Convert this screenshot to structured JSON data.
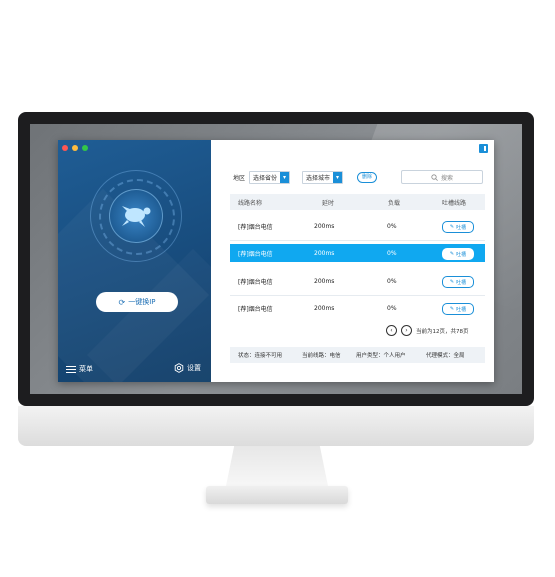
{
  "sidebar": {
    "connect_label": "一键换IP",
    "menu_label": "菜单",
    "settings_label": "设置"
  },
  "filter": {
    "region_label": "地区",
    "province_value": "选择省份",
    "city_value": "选择城市",
    "delete_label": "删除",
    "search_placeholder": "搜索"
  },
  "table": {
    "headers": [
      "线路名称",
      "延时",
      "负载",
      "吐槽线路"
    ],
    "rows": [
      {
        "name": "[荐]烟台电信",
        "latency": "200ms",
        "load": "0%",
        "action": "吐槽"
      },
      {
        "name": "[荐]烟台电信",
        "latency": "200ms",
        "load": "0%",
        "action": "吐槽"
      },
      {
        "name": "[荐]烟台电信",
        "latency": "200ms",
        "load": "0%",
        "action": "吐槽"
      },
      {
        "name": "[荐]烟台电信",
        "latency": "200ms",
        "load": "0%",
        "action": "吐槽"
      }
    ],
    "selected_row": 1
  },
  "pager": {
    "text": "当前为12页，共78页"
  },
  "status": {
    "state": "状态：连接不可用",
    "line": "当前线路：电信",
    "user_type": "用户类型：个人用户",
    "proxy_mode": "代理模式：全局"
  },
  "colors": {
    "accent": "#1a8fd8",
    "selected_row": "#10a8f0",
    "sidebar": "#1f5d95"
  }
}
